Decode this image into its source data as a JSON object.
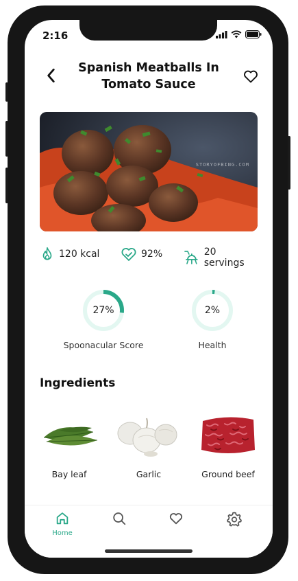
{
  "status_bar": {
    "time": "2:16",
    "icons": [
      "signal-icon",
      "wifi-icon",
      "battery-icon"
    ]
  },
  "header": {
    "back_icon": "chevron-left-icon",
    "title": "Spanish Meatballs In Tomato Sauce",
    "favorite_icon": "heart-outline-icon"
  },
  "photo": {
    "alt": "meatballs in tomato sauce",
    "watermark": "STORYOFBING.COM"
  },
  "stats": [
    {
      "icon": "flame-icon",
      "value": "120 kcal"
    },
    {
      "icon": "heart-check-icon",
      "value": "92%"
    },
    {
      "icon": "serving-tray-icon",
      "value": "20 servings"
    }
  ],
  "scores": [
    {
      "label": "Spoonacular Score",
      "value": "27%",
      "percent": 27
    },
    {
      "label": "Health",
      "value": "2%",
      "percent": 2
    }
  ],
  "ingredients_title": "Ingredients",
  "ingredients": [
    {
      "name": "Bay leaf",
      "image": "bay-leaf-image"
    },
    {
      "name": "Garlic",
      "image": "garlic-image"
    },
    {
      "name": "Ground beef",
      "image": "ground-beef-image"
    }
  ],
  "tabs": [
    {
      "icon": "home-icon",
      "label": "Home",
      "active": true
    },
    {
      "icon": "search-icon",
      "label": "",
      "active": false
    },
    {
      "icon": "heart-icon",
      "label": "",
      "active": false
    },
    {
      "icon": "gear-icon",
      "label": "",
      "active": false
    }
  ],
  "colors": {
    "accent": "#2aa889",
    "ring_track": "#e3f7f1",
    "icon_gray": "#555555"
  }
}
